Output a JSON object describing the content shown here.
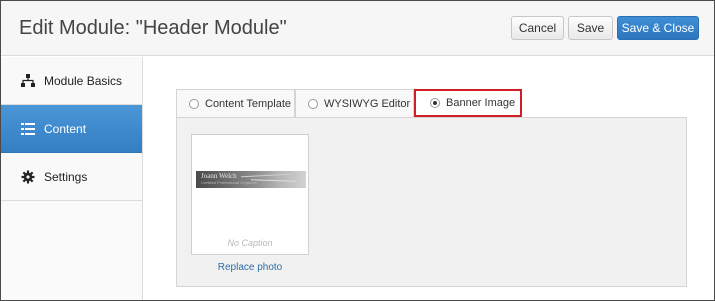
{
  "header": {
    "title": "Edit Module: \"Header Module\"",
    "cancel_label": "Cancel",
    "save_label": "Save",
    "save_close_label": "Save & Close"
  },
  "sidebar": {
    "items": [
      {
        "label": "Module Basics",
        "icon": "sitemap-icon"
      },
      {
        "label": "Content",
        "icon": "list-icon",
        "active": true
      },
      {
        "label": "Settings",
        "icon": "gear-icon"
      }
    ]
  },
  "tabs": [
    {
      "label": "Content Template",
      "selected": false
    },
    {
      "label": "WYSIWYG Editor",
      "selected": false
    },
    {
      "label": "Banner Image",
      "selected": true
    }
  ],
  "photo": {
    "banner_name": "Joann Welch",
    "banner_sub": "Certified Professional Organizer",
    "caption": "No Caption",
    "replace_label": "Replace photo"
  },
  "colors": {
    "accent": "#3a86cc",
    "highlight": "#d01e25"
  }
}
